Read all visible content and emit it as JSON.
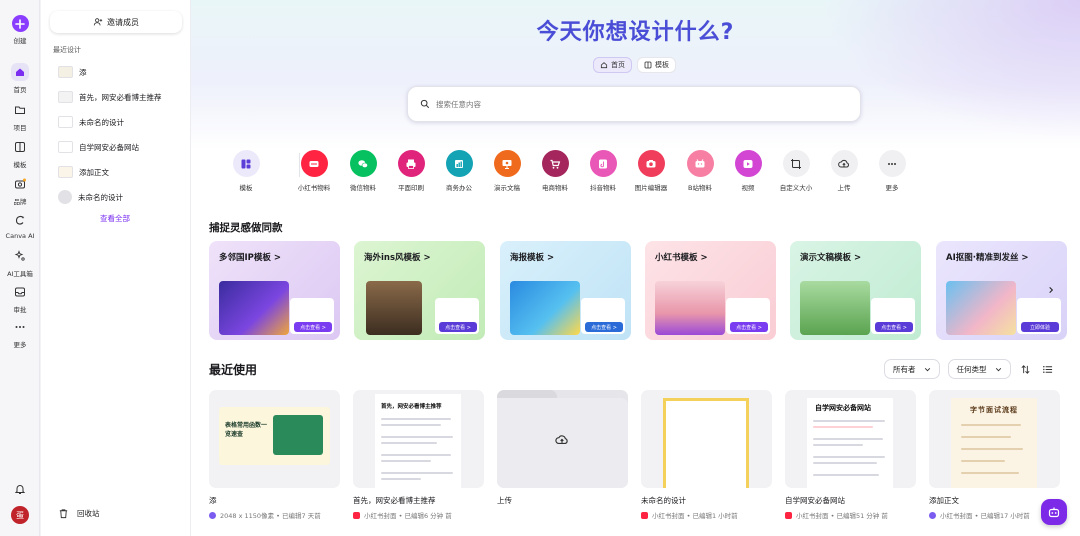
{
  "rail": {
    "create": "创建",
    "home": "首页",
    "projects": "项目",
    "templates": "模板",
    "brand": "品牌",
    "canva_ai": "Canva AI",
    "ai_tools": "AI工具箱",
    "approve": "审批",
    "more": "更多",
    "avatar": "蛋"
  },
  "panel": {
    "invite": "邀请成员",
    "recent_heading": "最近设计",
    "recent": [
      {
        "label": "添"
      },
      {
        "label": "首先，网安必看博主推荐"
      },
      {
        "label": "未命名的设计"
      },
      {
        "label": "自学网安必备网站"
      },
      {
        "label": "添加正文"
      },
      {
        "label": "未命名的设计"
      }
    ],
    "view_all": "查看全部",
    "trash": "回收站"
  },
  "hero": {
    "title": "今天你想设计什么?",
    "tabs": [
      {
        "label": "首页"
      },
      {
        "label": "模板"
      }
    ],
    "search_placeholder": "搜索任意内容"
  },
  "categories": [
    {
      "label": "模板",
      "color": "#ece9fb",
      "icon": "template-icon"
    },
    {
      "label": "小红书物料",
      "color": "#ff2442",
      "icon": "xiaohongshu-icon"
    },
    {
      "label": "微信物料",
      "color": "#07c160",
      "icon": "wechat-icon"
    },
    {
      "label": "平面印刷",
      "color": "#e0247c",
      "icon": "printer-icon"
    },
    {
      "label": "商务办公",
      "color": "#13a3b5",
      "icon": "office-icon"
    },
    {
      "label": "演示文稿",
      "color": "#f06a1d",
      "icon": "presentation-icon"
    },
    {
      "label": "电商物料",
      "color": "#a4265c",
      "icon": "cart-icon"
    },
    {
      "label": "抖音物料",
      "color": "#e957b7",
      "icon": "tiktok-icon"
    },
    {
      "label": "图片编辑器",
      "color": "#ef3d5b",
      "icon": "camera-icon"
    },
    {
      "label": "B站物料",
      "color": "#f87fa4",
      "icon": "bilibili-icon"
    },
    {
      "label": "视频",
      "color": "#d346d4",
      "icon": "video-icon"
    },
    {
      "label": "自定义大小",
      "color": "#f0f0f3",
      "icon": "custom-size-icon"
    },
    {
      "label": "上传",
      "color": "#f0f0f3",
      "icon": "cloud-upload-icon"
    },
    {
      "label": "更多",
      "color": "#f0f0f3",
      "icon": "more-icon"
    }
  ],
  "inspiration": {
    "title": "捕捉灵感做同款",
    "cards": [
      {
        "title": "多邻国IP模板 >",
        "bg": "#e7d6f7",
        "accent": "#7a3cf0",
        "button": "点击查看 >"
      },
      {
        "title": "海外ins风模板 >",
        "bg": "#cdeec4",
        "accent": "#5a3bd8",
        "button": "点击查看 >"
      },
      {
        "title": "海报模板 >",
        "bg": "#cce9f8",
        "accent": "#2a6bd8",
        "button": "点击查看 >"
      },
      {
        "title": "小红书模板 >",
        "bg": "#fbd9de",
        "accent": "#7a3cf0",
        "button": "点击查看 >"
      },
      {
        "title": "演示文稿模板 >",
        "bg": "#cdeedb",
        "accent": "#5a3bd8",
        "button": "点击查看 >"
      },
      {
        "title": "AI抠图·精准到发丝 >",
        "bg": "#e2ddfb",
        "accent": "#5a3bd8",
        "button": "立即体验"
      }
    ]
  },
  "recent_use": {
    "title": "最近使用",
    "filter_owner": "所有者",
    "filter_type": "任何类型",
    "items": [
      {
        "name": "添",
        "meta": "2048 x 1150像素 • 已编辑7 天前",
        "badge": "#7b5cf0"
      },
      {
        "name": "首先，网安必看博主推荐",
        "meta": "小红书封面 • 已编辑6 分钟 前",
        "badge": "#ff2442"
      },
      {
        "name": "上传",
        "meta": "",
        "badge": ""
      },
      {
        "name": "未命名的设计",
        "meta": "小红书封面 • 已编辑1 小时前",
        "badge": "#ff2442"
      },
      {
        "name": "自学网安必备网站",
        "meta": "小红书封面 • 已编辑51 分钟 前",
        "badge": "#ff2442"
      },
      {
        "name": "添加正文",
        "meta": "小红书封面 • 已编辑17 小时前",
        "badge": "#7b5cf0"
      }
    ],
    "preview_texts": {
      "card1": "表格常用函数一览速查",
      "card2_title": "首先，网安必看博主推荐",
      "card5_title": "自学网安必备网站",
      "card6_title": "字节面试流程"
    }
  }
}
